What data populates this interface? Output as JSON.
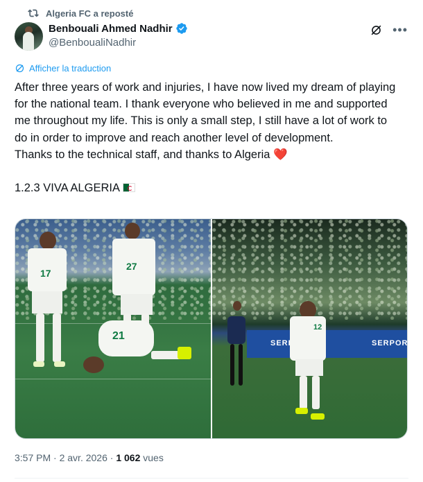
{
  "repost": {
    "label": "Algeria FC a reposté",
    "icon": "repost-icon"
  },
  "author": {
    "name": "Benbouali Ahmed Nadhir",
    "handle": "@BenboualiNadhir",
    "verified": true,
    "verified_icon": "verified-badge-icon",
    "verified_color": "#1d9bf0"
  },
  "top_actions": {
    "grok_icon": "grok-icon",
    "more_icon": "more-icon",
    "more_label": "•••"
  },
  "translate": {
    "label": "Afficher la traduction",
    "icon": "translate-icon",
    "color": "#1d9bf0"
  },
  "tweet": {
    "paragraph_1": "After three years of work and injuries, I have now lived my dream of playing for the national team. I thank everyone who believed in me and supported me throughout my life. This is only a small step, I still have a lot of work to do in order to improve and reach another level of development.",
    "paragraph_2": "Thanks to the technical staff, and thanks to Algeria",
    "heart_emoji": "❤️",
    "paragraph_3": "1.2.3 VIVA ALGERIA",
    "flag_emoji": "algeria-flag"
  },
  "media": {
    "left_photo": {
      "numbers": [
        "17",
        "27",
        "21"
      ]
    },
    "right_photo": {
      "numbers": [
        "12"
      ],
      "board_text": "SERPORT"
    }
  },
  "meta": {
    "time": "3:57 PM",
    "separator": "·",
    "date": "2 avr. 2026",
    "views_count": "1 062",
    "views_label": "vues"
  },
  "colors": {
    "text": "#0f1419",
    "secondary": "#536471",
    "accent": "#1d9bf0",
    "heart": "#dd2e44"
  }
}
